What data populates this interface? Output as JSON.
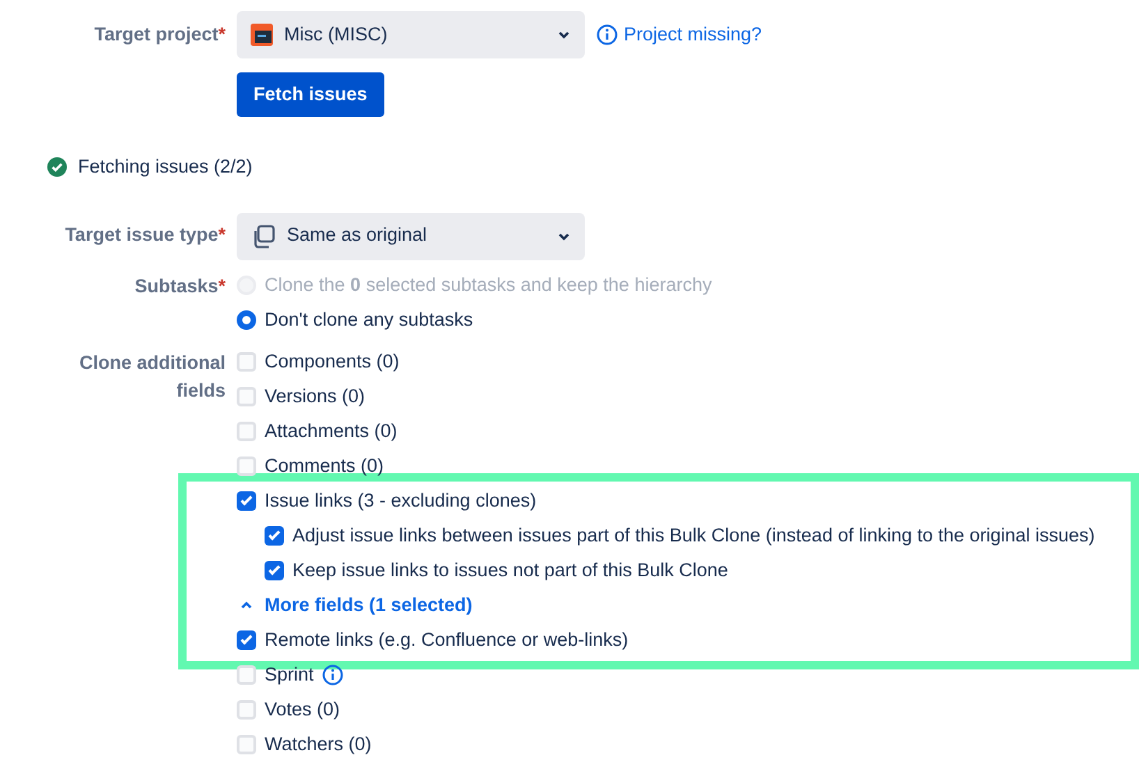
{
  "target_project": {
    "label": "Target project",
    "required_mark": "*",
    "value": "Misc (MISC)",
    "help_link": "Project missing?"
  },
  "fetch_button": "Fetch issues",
  "fetch_status": {
    "text": "Fetching issues (2/2)",
    "done": true
  },
  "target_issue_type": {
    "label": "Target issue type",
    "required_mark": "*",
    "value": "Same as original"
  },
  "subtasks": {
    "label": "Subtasks",
    "required_mark": "*",
    "options": [
      {
        "text": "Clone the **0** selected subtasks and keep the hierarchy",
        "selected": false,
        "disabled": true
      },
      {
        "text": "Don't clone any subtasks",
        "selected": true,
        "disabled": false
      }
    ]
  },
  "additional_fields": {
    "label": "Clone additional fields",
    "items": [
      {
        "kind": "checkbox",
        "text": "Components (0)",
        "checked": false
      },
      {
        "kind": "checkbox",
        "text": "Versions (0)",
        "checked": false
      },
      {
        "kind": "checkbox",
        "text": "Attachments (0)",
        "checked": false
      },
      {
        "kind": "checkbox",
        "text": "Comments (0)",
        "checked": false
      },
      {
        "kind": "checkbox",
        "text": "Issue links (3 - excluding clones)",
        "checked": true,
        "highlighted": true,
        "children": [
          {
            "kind": "checkbox",
            "text": "Adjust issue links between issues part of this Bulk Clone (instead of linking to the original issues)",
            "checked": true
          },
          {
            "kind": "checkbox",
            "text": "Keep issue links to issues not part of this Bulk Clone",
            "checked": true
          }
        ]
      },
      {
        "kind": "toggle",
        "text": "More fields (1 selected)",
        "expanded": true,
        "highlighted": true
      },
      {
        "kind": "checkbox",
        "text": "Remote links (e.g. Confluence or web-links)",
        "checked": true,
        "highlighted": true
      },
      {
        "kind": "checkbox",
        "text": "Sprint",
        "checked": false,
        "info": true
      },
      {
        "kind": "checkbox",
        "text": "Votes (0)",
        "checked": false
      },
      {
        "kind": "checkbox",
        "text": "Watchers (0)",
        "checked": false
      }
    ]
  }
}
